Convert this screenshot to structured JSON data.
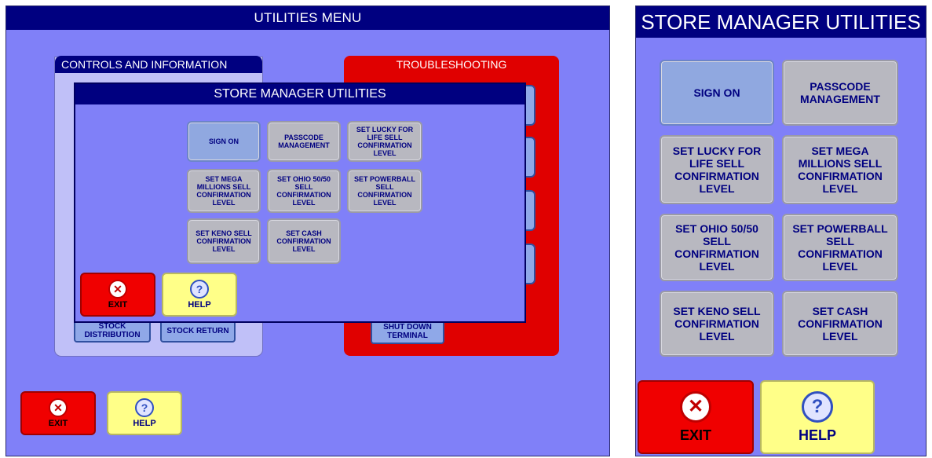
{
  "left": {
    "title": "UTILITIES MENU",
    "controls_tab": "CONTROLS AND INFORMATION",
    "trouble_tab": "TROUBLESHOOTING",
    "stock_distribution": "STOCK DISTRIBUTION",
    "stock_return": "STOCK RETURN",
    "shut_down": "SHUT DOWN TERMINAL",
    "exit_label": "EXIT",
    "help_label": "HELP",
    "modal": {
      "title": "STORE MANAGER UTILITIES",
      "buttons": [
        "SIGN ON",
        "PASSCODE MANAGEMENT",
        "SET LUCKY FOR LIFE SELL CONFIRMATION LEVEL",
        "SET MEGA MILLIONS SELL CONFIRMATION LEVEL",
        "SET OHIO 50/50 SELL CONFIRMATION LEVEL",
        "SET POWERBALL SELL CONFIRMATION LEVEL",
        "SET KENO SELL CONFIRMATION LEVEL",
        "SET CASH CONFIRMATION LEVEL"
      ],
      "exit_label": "EXIT",
      "help_label": "HELP"
    }
  },
  "right": {
    "title": "STORE MANAGER UTILITIES",
    "buttons": [
      "SIGN ON",
      "PASSCODE MANAGEMENT",
      "SET LUCKY FOR LIFE SELL CONFIRMATION LEVEL",
      "SET MEGA MILLIONS SELL CONFIRMATION LEVEL",
      "SET OHIO 50/50 SELL CONFIRMATION LEVEL",
      "SET POWERBALL SELL CONFIRMATION LEVEL",
      "SET KENO SELL CONFIRMATION LEVEL",
      "SET CASH CONFIRMATION LEVEL"
    ],
    "exit_label": "EXIT",
    "help_label": "HELP"
  },
  "icons": {
    "exit": "close-circle-icon",
    "help": "question-circle-icon"
  },
  "colors": {
    "background": "#8080f8",
    "title_bar": "#000080",
    "exit": "#f00000",
    "help": "#ffff88",
    "trouble": "#e00000"
  }
}
